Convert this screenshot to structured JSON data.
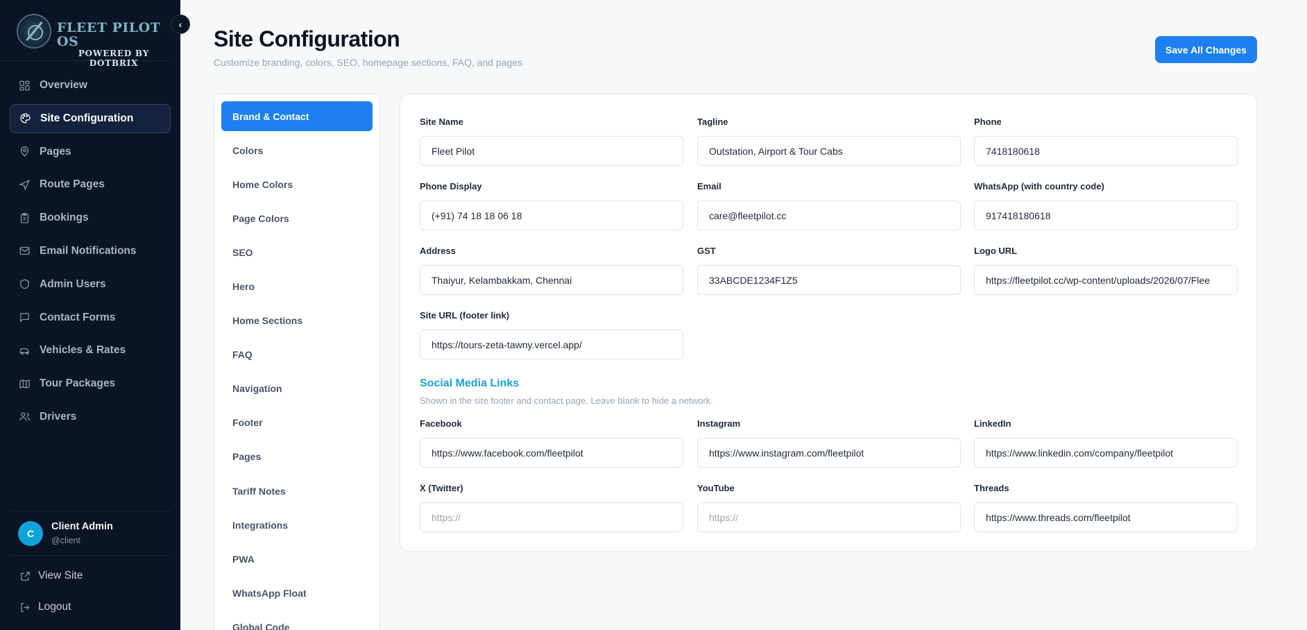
{
  "brand": {
    "name": "FLEET PILOT OS",
    "sub": "POWERED BY DOTBRIX"
  },
  "nav": [
    {
      "label": "Overview",
      "icon": "grid-icon"
    },
    {
      "label": "Site Configuration",
      "icon": "palette-icon"
    },
    {
      "label": "Pages",
      "icon": "map-pin-icon"
    },
    {
      "label": "Route Pages",
      "icon": "navigation-icon"
    },
    {
      "label": "Bookings",
      "icon": "clipboard-icon"
    },
    {
      "label": "Email Notifications",
      "icon": "mail-icon"
    },
    {
      "label": "Admin Users",
      "icon": "shield-icon"
    },
    {
      "label": "Contact Forms",
      "icon": "message-icon"
    },
    {
      "label": "Vehicles & Rates",
      "icon": "car-icon"
    },
    {
      "label": "Tour Packages",
      "icon": "map-icon"
    },
    {
      "label": "Drivers",
      "icon": "users-icon"
    }
  ],
  "user": {
    "initial": "C",
    "name": "Client Admin",
    "handle": "@client"
  },
  "bottom": {
    "view_site": "View Site",
    "logout": "Logout"
  },
  "header": {
    "title": "Site Configuration",
    "subtitle": "Customize branding, colors, SEO, homepage sections, FAQ, and pages",
    "save_label": "Save All Changes"
  },
  "tabs": [
    "Brand & Contact",
    "Colors",
    "Home Colors",
    "Page Colors",
    "SEO",
    "Hero",
    "Home Sections",
    "FAQ",
    "Navigation",
    "Footer",
    "Pages",
    "Tariff Notes",
    "Integrations",
    "PWA",
    "WhatsApp Float",
    "Global Code"
  ],
  "fields": {
    "site_name": {
      "label": "Site Name",
      "value": "Fleet Pilot"
    },
    "tagline": {
      "label": "Tagline",
      "value": "Outstation, Airport & Tour Cabs"
    },
    "phone": {
      "label": "Phone",
      "value": "7418180618"
    },
    "phone_display": {
      "label": "Phone Display",
      "value": "(+91) 74 18 18 06 18"
    },
    "email": {
      "label": "Email",
      "value": "care@fleetpilot.cc"
    },
    "whatsapp": {
      "label": "WhatsApp (with country code)",
      "value": "917418180618"
    },
    "address": {
      "label": "Address",
      "value": "Thaiyur, Kelambakkam, Chennai"
    },
    "gst": {
      "label": "GST",
      "value": "33ABCDE1234F1Z5"
    },
    "logo_url": {
      "label": "Logo URL",
      "value": "https://fleetpilot.cc/wp-content/uploads/2026/07/Flee"
    },
    "site_url": {
      "label": "Site URL (footer link)",
      "value": "https://tours-zeta-tawny.vercel.app/"
    }
  },
  "social": {
    "title": "Social Media Links",
    "description": "Shown in the site footer and contact page. Leave blank to hide a network.",
    "facebook": {
      "label": "Facebook",
      "value": "https://www.facebook.com/fleetpilot"
    },
    "instagram": {
      "label": "Instagram",
      "value": "https://www.instagram.com/fleetpilot"
    },
    "linkedin": {
      "label": "LinkedIn",
      "value": "https://www.linkedin.com/company/fleetpilot"
    },
    "twitter": {
      "label": "X (Twitter)",
      "value": "",
      "placeholder": "https://"
    },
    "youtube": {
      "label": "YouTube",
      "value": "",
      "placeholder": "https://"
    },
    "threads": {
      "label": "Threads",
      "value": "https://www.threads.com/fleetpilot"
    }
  },
  "colors": {
    "accent": "#1e80f0",
    "sidebar": "#0b1424",
    "social_title": "#1aa0d8"
  }
}
